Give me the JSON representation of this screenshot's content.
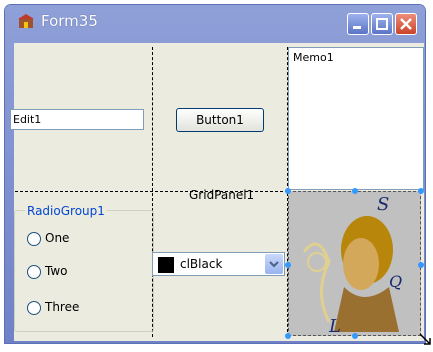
{
  "window": {
    "title": "Form35"
  },
  "edit": {
    "value": "Edit1"
  },
  "button": {
    "label": "Button1"
  },
  "memo": {
    "text": "Memo1"
  },
  "gridpanel": {
    "label": "GridPanel1"
  },
  "radiogroup": {
    "caption": "RadioGroup1",
    "items": [
      "One",
      "Two",
      "Three"
    ]
  },
  "colorbox": {
    "value": "clBlack",
    "swatch_color": "#000000"
  },
  "colors": {
    "title_bar": "#7b8ecf",
    "client": "#ecebdf",
    "accent": "#3399ff"
  },
  "icons": [
    "app-icon",
    "minimize-icon",
    "maximize-icon",
    "close-icon",
    "chevron-down-icon",
    "resize-grip-icon"
  ]
}
